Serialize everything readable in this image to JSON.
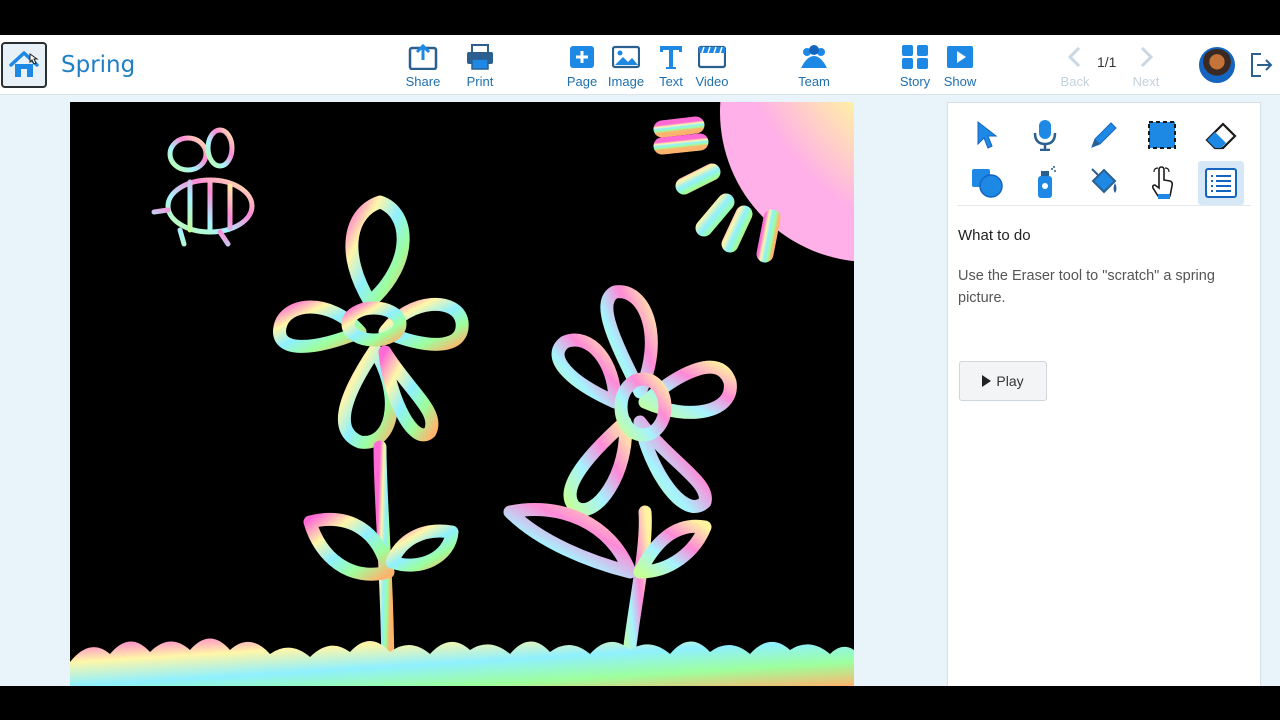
{
  "document": {
    "title": "Spring"
  },
  "toolbar": {
    "share": "Share",
    "print": "Print",
    "page": "Page",
    "image": "Image",
    "text": "Text",
    "video": "Video",
    "team": "Team",
    "story": "Story",
    "show": "Show",
    "back": "Back",
    "next": "Next",
    "page_count": "1/1"
  },
  "tools": [
    "select-icon",
    "microphone-icon",
    "pen-icon",
    "selection-box-icon",
    "eraser-icon",
    "shapes-icon",
    "spray-can-icon",
    "paint-bucket-icon",
    "touch-hand-icon",
    "instructions-list-icon"
  ],
  "panel": {
    "heading": "What to do",
    "instructions": "Use the Eraser tool to \"scratch\" a spring picture.",
    "play_label": "Play"
  },
  "colors": {
    "accent": "#1e88e5",
    "title": "#1f7fc4",
    "active_tool": "#d6e8f8",
    "canvas": "#000000"
  }
}
